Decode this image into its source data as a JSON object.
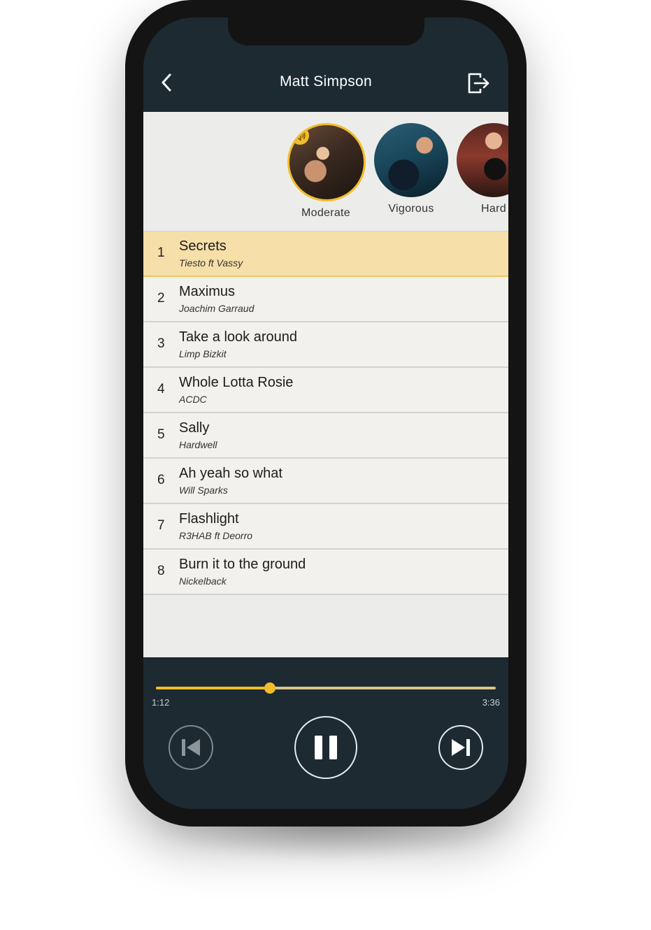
{
  "header": {
    "title": "Matt Simpson"
  },
  "modes": [
    {
      "label": "Moderate",
      "selected": true
    },
    {
      "label": "Vigorous",
      "selected": false
    },
    {
      "label": "Hard",
      "selected": false
    }
  ],
  "tracks": [
    {
      "num": "1",
      "name": "Secrets",
      "artist": "Tiesto ft Vassy",
      "active": true
    },
    {
      "num": "2",
      "name": "Maximus",
      "artist": "Joachim Garraud",
      "active": false
    },
    {
      "num": "3",
      "name": "Take a look around",
      "artist": "Limp Bizkit",
      "active": false
    },
    {
      "num": "4",
      "name": "Whole Lotta Rosie",
      "artist": "ACDC",
      "active": false
    },
    {
      "num": "5",
      "name": "Sally",
      "artist": "Hardwell",
      "active": false
    },
    {
      "num": "6",
      "name": "Ah yeah so what",
      "artist": "Will Sparks",
      "active": false
    },
    {
      "num": "7",
      "name": "Flashlight",
      "artist": "R3HAB ft Deorro",
      "active": false
    },
    {
      "num": "8",
      "name": "Burn it to the ground",
      "artist": "Nickelback",
      "active": false
    }
  ],
  "player": {
    "current_time": "1:12",
    "total_time": "3:36",
    "progress": 0.335,
    "state": "playing"
  },
  "colors": {
    "accent": "#f1bd2c",
    "dark_bg": "#1d2a32",
    "active_row": "#f6dfa8",
    "list_bg": "#f2f1ed"
  },
  "icons": {
    "back": "chevron-left-icon",
    "exit": "logout-icon",
    "sound": "speaker-icon",
    "prev": "skip-previous-icon",
    "pause": "pause-icon",
    "next": "skip-next-icon"
  }
}
